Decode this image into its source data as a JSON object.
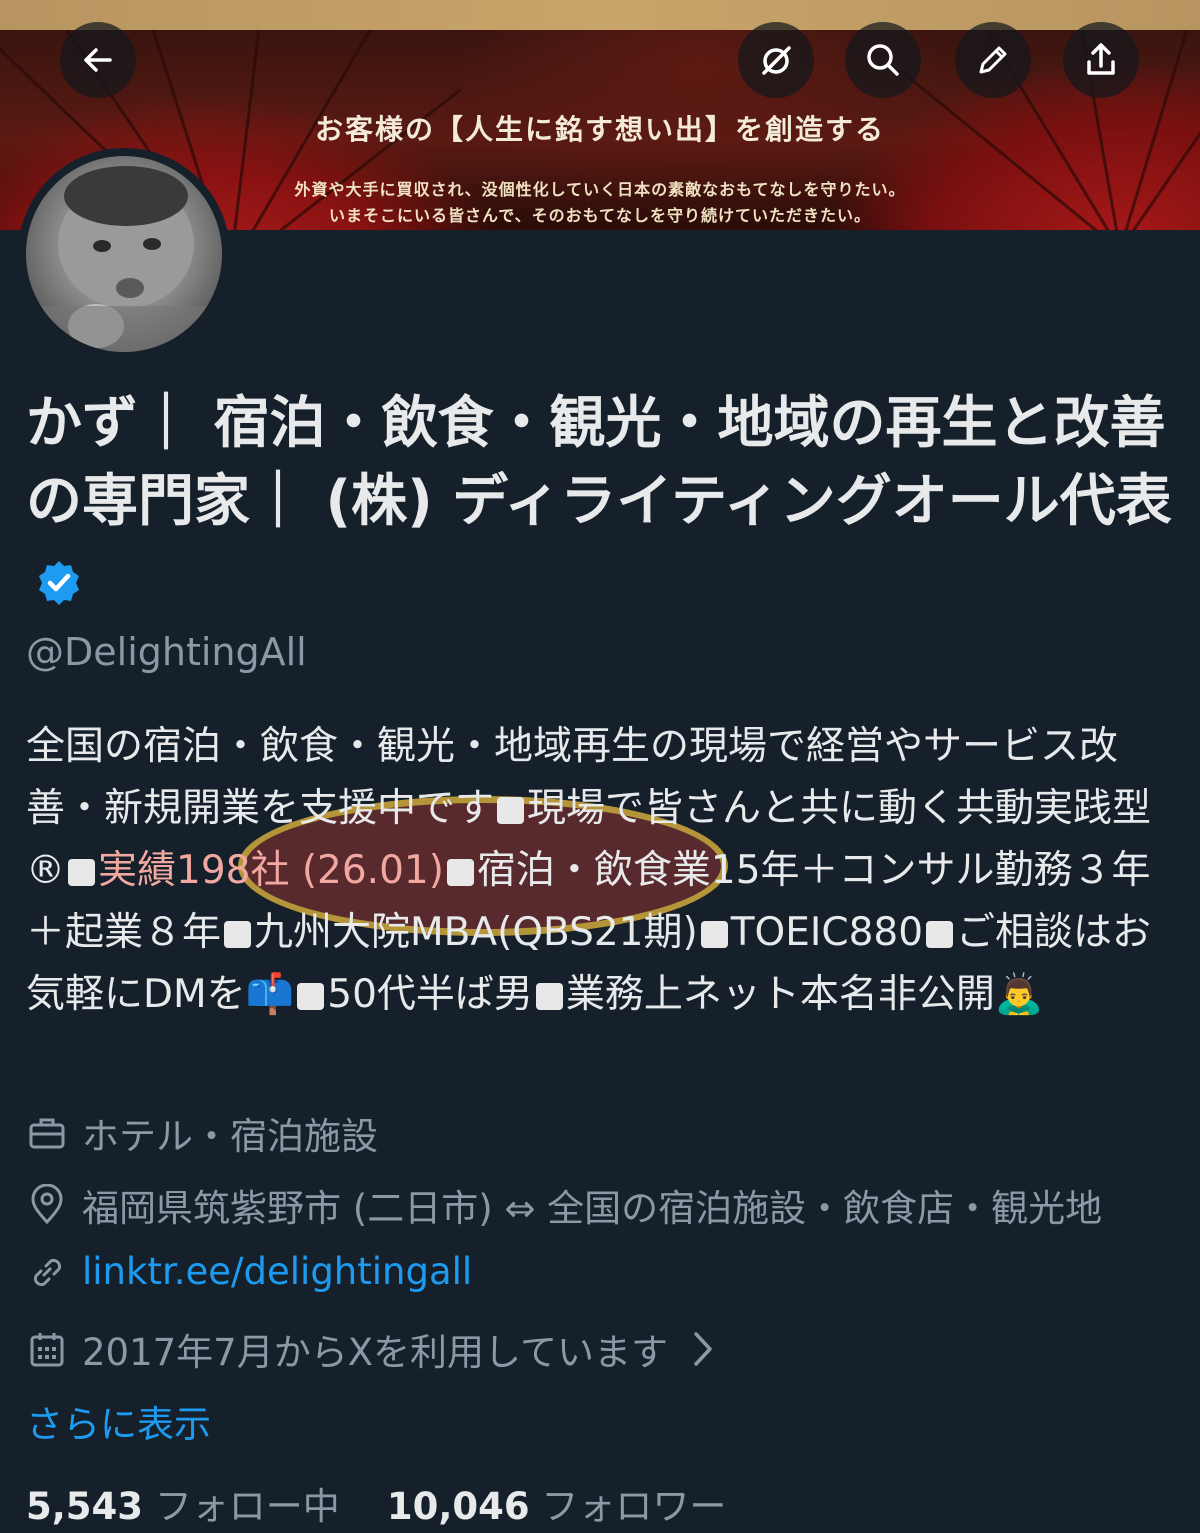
{
  "banner": {
    "title": "お客様の【人生に銘す想い出】を創造する",
    "sub_line1": "外資や大手に買収され、没個性化していく日本の素敵なおもてなしを守りたい。",
    "sub_line2": "いまそこにいる皆さんで、そのおもてなしを守り続けていただきたい。"
  },
  "controls": [
    "back-arrow-icon",
    "grok-icon",
    "search-icon",
    "edit-icon",
    "share-icon"
  ],
  "profile": {
    "name": "かず｜ 宿泊・飲食・観光・地域の再生と改善の専門家｜ (株) ディライティングオール代表",
    "handle": "@DelightingAll",
    "verified": true,
    "bio_before": "全国の宿泊・飲食・観光・地域再生の現場で経営やサービス改善・新規開業を支援中です",
    "bio_p2": "現場で皆さんと共に動く共動実践型®",
    "bio_highlight": "実績198社 (26.01)",
    "bio_p3": "宿泊・飲食業15年＋コンサル勤務３年＋起業８年",
    "bio_p4": "九州大院MBA(QBS21期)",
    "bio_p5": "TOEIC880",
    "bio_p6": "ご相談はお気軽にDMを",
    "bio_emoji1": "📫",
    "bio_p7": "50代半ば男",
    "bio_p8": "業務上ネット本名非公開",
    "bio_emoji2": "🙇‍♂️",
    "category": "ホテル・宿泊施設",
    "location": "福岡県筑紫野市 (二日市) ⇔ 全国の宿泊施設・飲食店・観光地",
    "url": "linktr.ee/delightingall",
    "joined": "2017年7月からXを利用しています",
    "show_more": "さらに表示",
    "following_count": "5,543",
    "following_label": "フォロー中",
    "followers_count": "10,046",
    "followers_label": "フォロワー"
  },
  "colors": {
    "background": "#15202b",
    "link": "#1d9bf0",
    "muted": "#8b98a5",
    "verified": "#1d9bf0"
  }
}
